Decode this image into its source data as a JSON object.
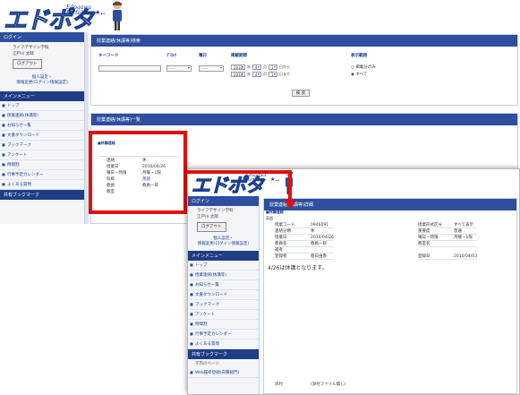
{
  "brand": {
    "logo_text": "エドポタ",
    "logo_sub_line1": "Edogawa",
    "logo_sub_line2": "Portal",
    "deco": "★.."
  },
  "sidebar": {
    "login_header": "ログイン",
    "user_dept": "ライフデザイン学科",
    "user_name": "江戸川 太郎",
    "logout_label": "ログアウト",
    "settings_line1": "個人設定・",
    "settings_line2": "情報変更(ログイン情報設定)",
    "menu_header": "メインメニュー",
    "items": [
      {
        "label": "トップ"
      },
      {
        "label": "授業連絡(休講等)"
      },
      {
        "label": "お知らせ一覧"
      },
      {
        "label": "文書ダウンロード"
      },
      {
        "label": "ブックマーク"
      },
      {
        "label": "アンケート"
      },
      {
        "label": "時間割"
      },
      {
        "label": "行事予定カレンダー"
      },
      {
        "label": "よくある質問"
      }
    ],
    "bookmark_header": "共有ブックマーク",
    "bookmark_items": [
      {
        "label": "学内のページ"
      },
      {
        "label": "Web履修登録(白鷺組門)"
      }
    ]
  },
  "search": {
    "title": "授業連絡(休講等)検索",
    "keyword_label": "キーワード",
    "period_label": "ﾌﾞﾛｯｸ",
    "weekday_label": "曜日",
    "date_label": "掲載期間",
    "display_label": "表示範囲",
    "period_value": "-----",
    "weekday_value": "-----",
    "from": {
      "year": "2010",
      "month": "4",
      "day": "1",
      "suffix": "日から"
    },
    "to": {
      "year": "2010",
      "month": "4",
      "day": "1",
      "suffix": "日まで"
    },
    "unit_year": "年",
    "unit_month": "月",
    "radio_option1": "掲載分のみ",
    "radio_option2": "すべて",
    "search_button": "検 索"
  },
  "list": {
    "title": "授業連絡(休講等)一覧",
    "section": "■休講連絡",
    "rows": [
      {
        "key": "連絡",
        "value": "休"
      },
      {
        "key": "授業日",
        "value": "2010/04/26"
      },
      {
        "key": "曜日・時限",
        "value": "月曜・1限"
      },
      {
        "key": "科目",
        "value": "英語"
      },
      {
        "key": "教員",
        "value": "教員一郎"
      },
      {
        "key": "教室",
        "value": ""
      }
    ]
  },
  "detail": {
    "title": "授業連絡(休講等)詳細",
    "section": "■休講連絡",
    "subject_header": "英語",
    "left": [
      {
        "key": "授業コード",
        "value": "0946091"
      },
      {
        "key": "連絡分類",
        "value": "休"
      },
      {
        "key": "授業日",
        "value": "2010/04/26"
      },
      {
        "key": "教員名",
        "value": "教員一郎"
      },
      {
        "key": "補考",
        "value": ""
      },
      {
        "key": "登録者",
        "value": "春日由香"
      }
    ],
    "right": [
      {
        "key": "授業形式区分",
        "value": "すべて表示"
      },
      {
        "key": "重要度",
        "value": "普通"
      },
      {
        "key": "曜日・時限",
        "value": "月曜・1限"
      },
      {
        "key": "教室名",
        "value": ""
      },
      {
        "key": "登録日",
        "value": "2010/04/03"
      }
    ],
    "body": "4/26は休講となります。",
    "attach_key": "添付",
    "attach_value": "(添付ファイル無し)"
  }
}
